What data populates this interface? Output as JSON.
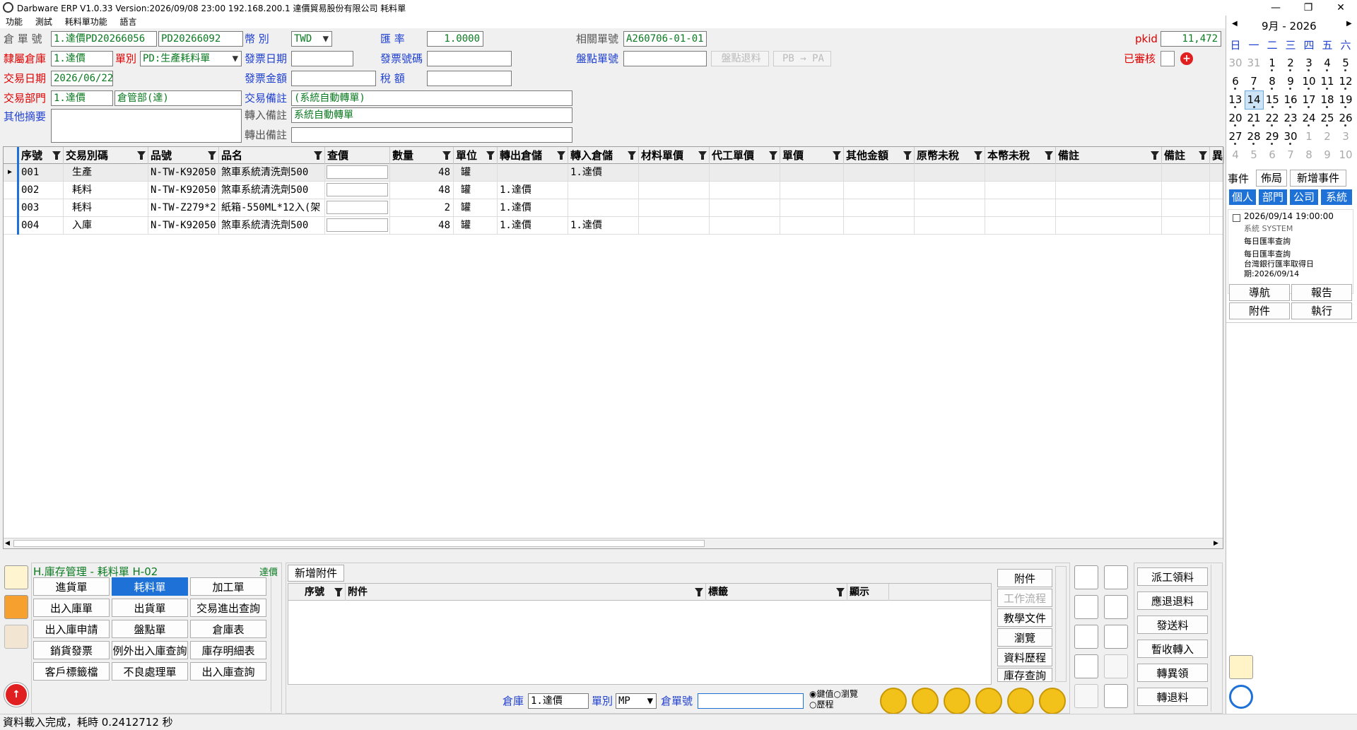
{
  "window": {
    "title": "Darbware ERP V1.0.33 Version:2026/09/08 23:00   192.168.200.1 達價貿易股份有限公司 耗料單",
    "minimize": "—",
    "maximize": "❐",
    "close": "✕"
  },
  "menu": [
    "功能",
    "測試",
    "耗料單功能",
    "語言"
  ],
  "form": {
    "warehouse_no_label": "倉 單 號",
    "warehouse_no": "1.達價PD20266056",
    "warehouse_no2": "PD20266092",
    "currency_label": "幣      別",
    "currency": "TWD",
    "rate_label": "匯      率",
    "rate": "1.0000",
    "related_no_label": "相關單號",
    "related_no": "A260706-01-01",
    "pkid_label": "pkid",
    "pkid": "11,472",
    "belong_wh_label": "隸屬倉庫",
    "belong_wh": "1.達價",
    "type_label": "單別",
    "type": "PD:生產耗料單",
    "invoice_date_label": "發票日期",
    "invoice_date": "",
    "invoice_no_label": "發票號碼",
    "invoice_no": "",
    "stock_no_label": "盤點單號",
    "stock_no": "",
    "stock_return_btn": "盤點退料",
    "pb_pa_btn": "PB → PA",
    "approved_label": "已審核",
    "trade_date_label": "交易日期",
    "trade_date": "2026/06/22",
    "invoice_amt_label": "發票金額",
    "invoice_amt": "",
    "tax_label": "稅      額",
    "tax": "",
    "dept_label": "交易部門",
    "dept": "1.達價",
    "dept_name": "倉管部(達)",
    "trade_note_label": "交易備註",
    "trade_note": "(系統自動轉單)",
    "other_label": "其他摘要",
    "other": "",
    "in_note_label": "轉入備註",
    "in_note": "系統自動轉單",
    "out_note_label": "轉出備註",
    "out_note": ""
  },
  "grid": {
    "columns": [
      "序號",
      "交易別碼",
      "品號",
      "品名",
      "查價",
      "數量",
      "單位",
      "轉出倉儲",
      "轉入倉儲",
      "材料單價",
      "代工單價",
      "單價",
      "其他金額",
      "原幣未稅",
      "本幣未稅",
      "備註",
      "備註",
      "異"
    ],
    "rows": [
      {
        "seq": "001",
        "code": "生產",
        "item": "N-TW-K92050",
        "name": "煞車系統清洗劑500",
        "qty": "48",
        "unit": "罐",
        "out": "",
        "in": "1.達價"
      },
      {
        "seq": "002",
        "code": "耗料",
        "item": "N-TW-K92050",
        "name": "煞車系統清洗劑500",
        "qty": "48",
        "unit": "罐",
        "out": "1.達價",
        "in": ""
      },
      {
        "seq": "003",
        "code": "耗料",
        "item": "N-TW-Z279*2",
        "name": "紙箱-550ML*12入(架",
        "qty": "2",
        "unit": "罐",
        "out": "1.達價",
        "in": ""
      },
      {
        "seq": "004",
        "code": "入庫",
        "item": "N-TW-K92050",
        "name": "煞車系統清洗劑500",
        "qty": "48",
        "unit": "罐",
        "out": "1.達價",
        "in": "1.達價"
      }
    ]
  },
  "module": {
    "title": "H.庫存管理 - 耗料單  H-02",
    "company": "達價",
    "buttons": [
      "進貨單",
      "耗料單",
      "加工單",
      "出入庫單",
      "出貨單",
      "交易進出查詢",
      "出入庫申請",
      "盤點單",
      "倉庫表",
      "銷貨發票",
      "例外出入庫查詢",
      "庫存明細表",
      "客戶標籤檔",
      "不良處理單",
      "出入庫查詢"
    ]
  },
  "attach": {
    "tab": "新增附件",
    "columns": [
      "序號",
      "附件",
      "標籤",
      "顯示"
    ],
    "side_buttons": [
      "附件",
      "工作流程",
      "教學文件",
      "瀏覽",
      "資料歷程",
      "庫存查詢"
    ]
  },
  "bottom": {
    "wh_label": "倉庫",
    "wh": "1.達價",
    "type_label": "單別",
    "type": "MP",
    "no_label": "倉單號",
    "no": "",
    "radio1": "鍵值",
    "radio2": "瀏覽",
    "radio3": "歷程"
  },
  "actions": [
    "派工領料",
    "應退退料",
    "發送料",
    "暫收轉入",
    "轉異領",
    "轉退料"
  ],
  "calendar": {
    "month": "9月",
    "sep": "-",
    "year": "2026",
    "weekdays": [
      "日",
      "一",
      "二",
      "三",
      "四",
      "五",
      "六"
    ],
    "weeks": [
      [
        "30",
        "31",
        "1",
        "2",
        "3",
        "4",
        "5"
      ],
      [
        "6",
        "7",
        "8",
        "9",
        "10",
        "11",
        "12"
      ],
      [
        "13",
        "14",
        "15",
        "16",
        "17",
        "18",
        "19"
      ],
      [
        "20",
        "21",
        "22",
        "23",
        "24",
        "25",
        "26"
      ],
      [
        "27",
        "28",
        "29",
        "30",
        "1",
        "2",
        "3"
      ],
      [
        "4",
        "5",
        "6",
        "7",
        "8",
        "9",
        "10"
      ]
    ],
    "today": "14"
  },
  "events": {
    "tab_event": "事件",
    "tab_layout": "佈局",
    "tab_new": "新增事件",
    "filters": [
      "個人",
      "部門",
      "公司",
      "系統"
    ],
    "item_time": "2026/09/14 19:00:00",
    "item_source": "系統  SYSTEM",
    "item_line1": "每日匯率查詢",
    "item_line2": "每日匯率查詢",
    "item_line3": "台灣銀行匯率取得日",
    "item_line4": "期:2026/09/14",
    "buttons": [
      "導航",
      "報告",
      "附件",
      "執行"
    ]
  },
  "status": "資料載入完成，耗時 0.2412712 秒"
}
